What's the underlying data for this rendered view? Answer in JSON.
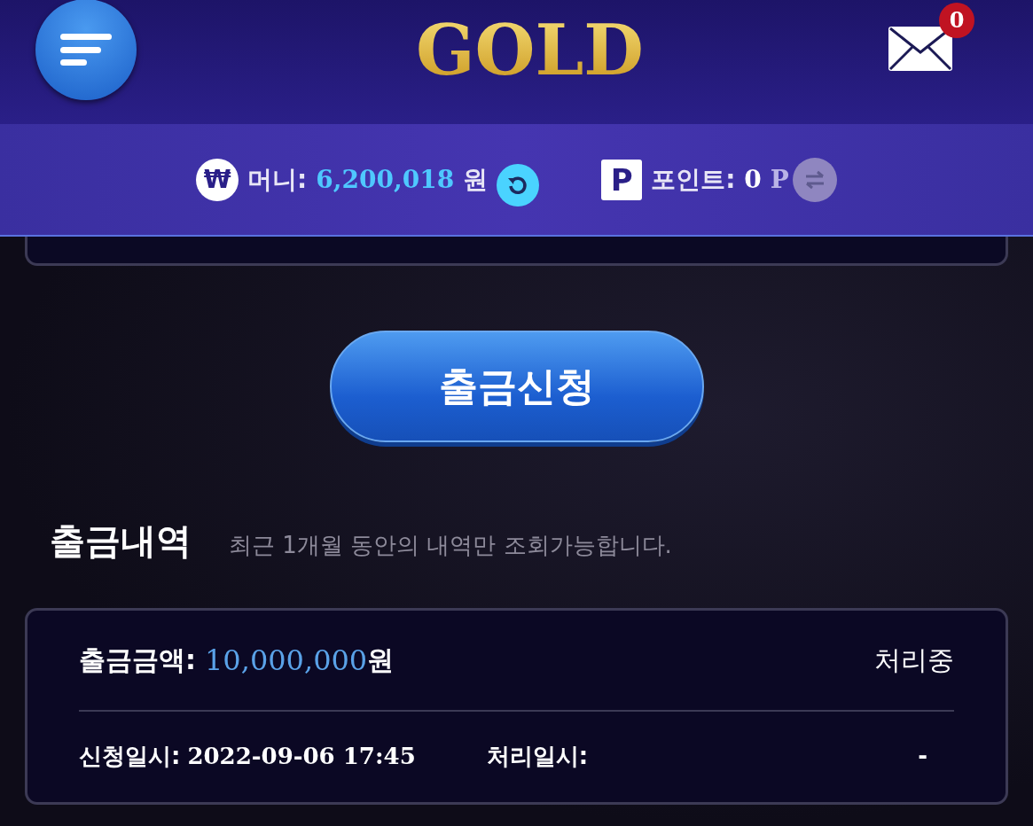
{
  "header": {
    "logo": "GOLD",
    "mail_count": "0"
  },
  "balance": {
    "money_icon": "₩",
    "money_label": "머니:",
    "money_value": "6,200,018",
    "money_unit": "원",
    "point_icon": "P",
    "point_label": "포인트:",
    "point_value": "0",
    "point_unit": "P"
  },
  "withdraw_button": "출금신청",
  "history": {
    "title": "출금내역",
    "note": "최근 1개월 동안의 내역만 조회가능합니다.",
    "records": [
      {
        "amount_label": "출금금액:",
        "amount": "10,000,000",
        "amount_unit": "원",
        "status": "처리중",
        "requested_label": "신청일시:",
        "requested_at": "2022-09-06 17:45",
        "processed_label": "처리일시:",
        "processed_at": "-"
      }
    ]
  }
}
